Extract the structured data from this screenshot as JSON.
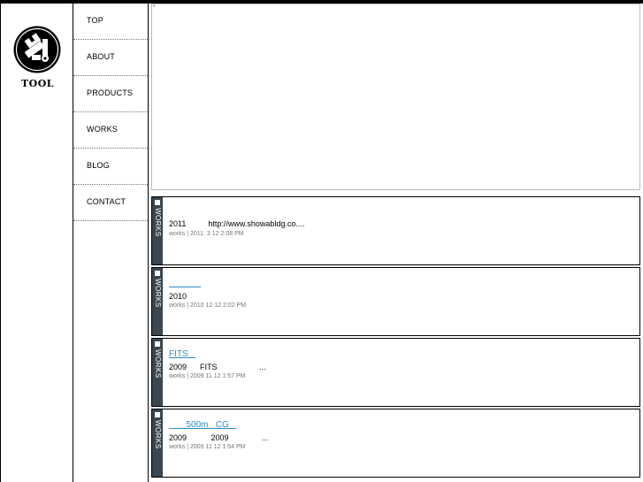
{
  "brand": {
    "logo_text": "TOOL"
  },
  "nav": {
    "items": [
      {
        "label": "TOP"
      },
      {
        "label": "ABOUT"
      },
      {
        "label": "PRODUCTS"
      },
      {
        "label": "WORKS"
      },
      {
        "label": "BLOG"
      },
      {
        "label": "CONTACT"
      }
    ]
  },
  "frame": {
    "marker": "*"
  },
  "posts": [
    {
      "category_tab": "WORKS",
      "title": "",
      "body": "2011          http://www.showabldg.co....",
      "meta": "works | 2011  3 12 2:08 PM"
    },
    {
      "category_tab": "WORKS",
      "title": "             ",
      "body": "2010",
      "meta": "works | 2010 12 12 2:02 PM"
    },
    {
      "category_tab": "WORKS",
      "title": "FITS   ",
      "body": "2009      FITS                   ...",
      "meta": "works | 2009 11 12 1:57 PM"
    },
    {
      "category_tab": "WORKS",
      "title": "       500m   CG   ",
      "body": "2009           2009               ...",
      "meta": "works | 2009 11 12 1:54 PM"
    }
  ],
  "colors": {
    "tab_bg": "#3a4650",
    "link": "#2f8dc6",
    "meta": "#777777"
  }
}
